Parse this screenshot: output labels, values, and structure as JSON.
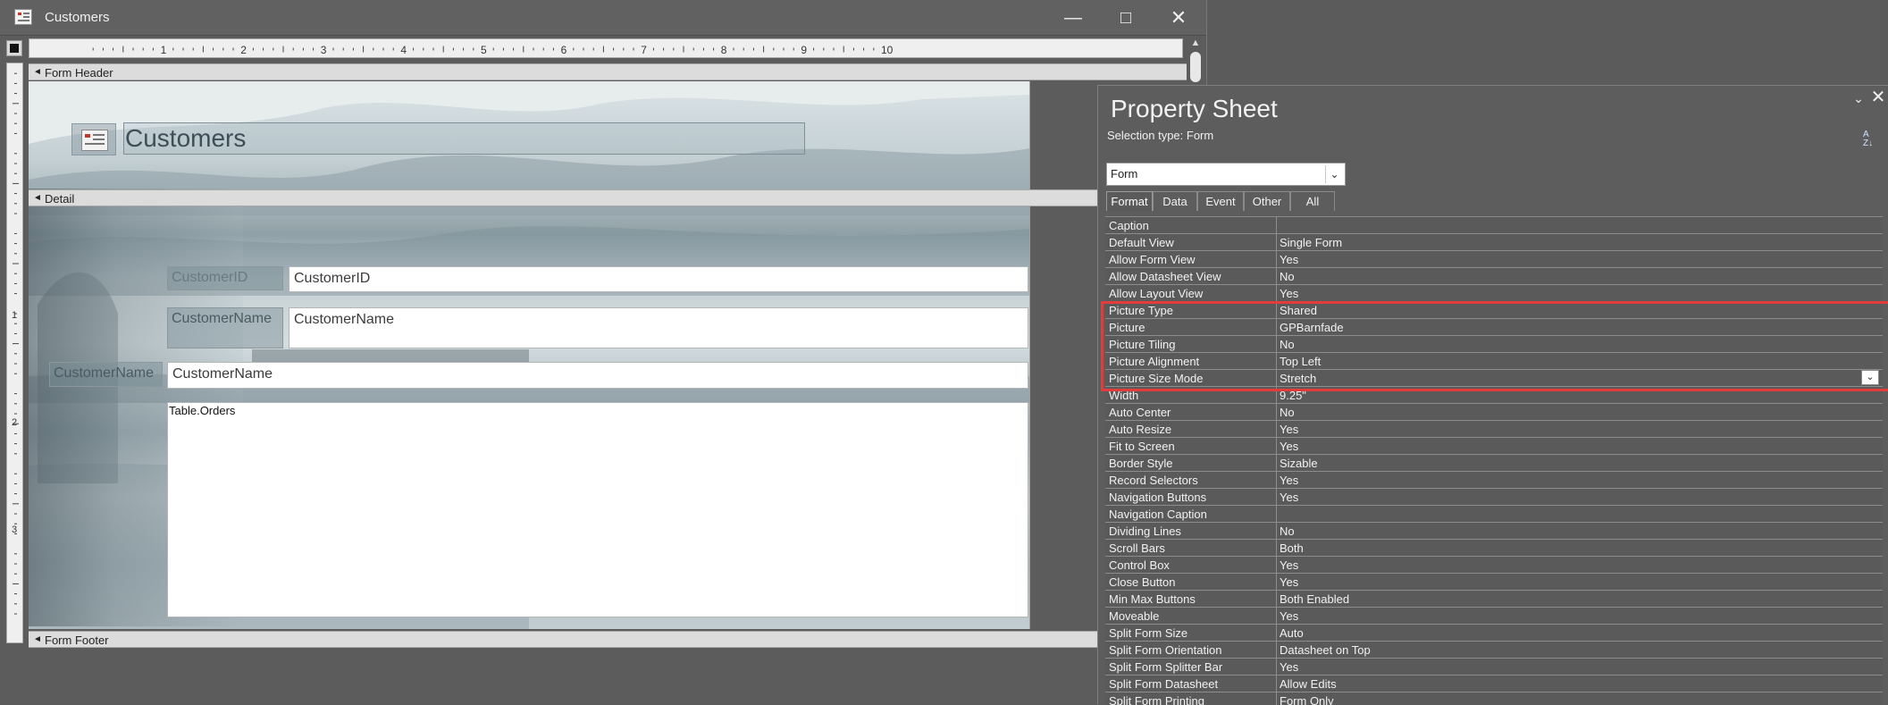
{
  "window": {
    "title": "Customers"
  },
  "ruler": {
    "h_numbers": [
      "1",
      "2",
      "3",
      "4",
      "5",
      "6",
      "7",
      "8",
      "9",
      "10"
    ],
    "v_numbers": [
      "1",
      "2",
      "3"
    ]
  },
  "sections": {
    "form_header": "Form Header",
    "detail": "Detail",
    "form_footer": "Form Footer"
  },
  "form_header": {
    "title": "Customers"
  },
  "detail": {
    "customerid_label": "CustomerID",
    "customerid_text": "CustomerID",
    "customername_label": "CustomerName",
    "customername_text": "CustomerName",
    "customername2_label": "CustomerName",
    "customername2_text": "CustomerName",
    "subform_label": "Table.Orders"
  },
  "property_sheet": {
    "title": "Property Sheet",
    "selection_type": "Selection type:  Form",
    "selected_object": "Form",
    "tabs": [
      "Format",
      "Data",
      "Event",
      "Other",
      "All"
    ],
    "active_tab": "Format",
    "properties": [
      {
        "name": "Caption",
        "value": ""
      },
      {
        "name": "Default View",
        "value": "Single Form"
      },
      {
        "name": "Allow Form View",
        "value": "Yes"
      },
      {
        "name": "Allow Datasheet View",
        "value": "No"
      },
      {
        "name": "Allow Layout View",
        "value": "Yes"
      },
      {
        "name": "Picture Type",
        "value": "Shared"
      },
      {
        "name": "Picture",
        "value": "GPBarnfade"
      },
      {
        "name": "Picture Tiling",
        "value": "No"
      },
      {
        "name": "Picture Alignment",
        "value": "Top Left"
      },
      {
        "name": "Picture Size Mode",
        "value": "Stretch"
      },
      {
        "name": "Width",
        "value": "9.25\""
      },
      {
        "name": "Auto Center",
        "value": "No"
      },
      {
        "name": "Auto Resize",
        "value": "Yes"
      },
      {
        "name": "Fit to Screen",
        "value": "Yes"
      },
      {
        "name": "Border Style",
        "value": "Sizable"
      },
      {
        "name": "Record Selectors",
        "value": "Yes"
      },
      {
        "name": "Navigation Buttons",
        "value": "Yes"
      },
      {
        "name": "Navigation Caption",
        "value": ""
      },
      {
        "name": "Dividing Lines",
        "value": "No"
      },
      {
        "name": "Scroll Bars",
        "value": "Both"
      },
      {
        "name": "Control Box",
        "value": "Yes"
      },
      {
        "name": "Close Button",
        "value": "Yes"
      },
      {
        "name": "Min Max Buttons",
        "value": "Both Enabled"
      },
      {
        "name": "Moveable",
        "value": "Yes"
      },
      {
        "name": "Split Form Size",
        "value": "Auto"
      },
      {
        "name": "Split Form Orientation",
        "value": "Datasheet on Top"
      },
      {
        "name": "Split Form Splitter Bar",
        "value": "Yes"
      },
      {
        "name": "Split Form Datasheet",
        "value": "Allow Edits"
      },
      {
        "name": "Split Form Printing",
        "value": "Form Only"
      }
    ]
  },
  "colors": {
    "highlight": "#e23c3c",
    "panel": "#5d5d5d"
  }
}
